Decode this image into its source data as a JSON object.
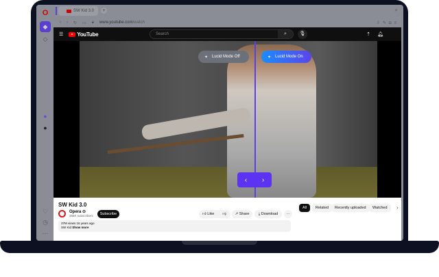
{
  "browser": {
    "tab_title": "SW Kid 3.0",
    "url_host": "www.youtube.com",
    "url_path": "/watch",
    "accent": "#5a3fd0"
  },
  "youtube": {
    "logo": "YouTube",
    "search_placeholder": "Search"
  },
  "lucid": {
    "off_label": "Lucid Mode Off",
    "on_label": "Lucid Mode On",
    "accent": "#5b33f0"
  },
  "video": {
    "title": "SW Kid 3.0",
    "channel": "Opera",
    "verified_icon": "⊙",
    "subscribers": "356K subscribers",
    "subscribe": "Subscribe",
    "like": "Like",
    "share": "Share",
    "download": "Download",
    "more": "···",
    "meta": "37M views  16 years ago",
    "desc": "SW Kid",
    "show_more": "Show more"
  },
  "chips": [
    "All",
    "Related",
    "Recently uploaded",
    "Watched"
  ]
}
